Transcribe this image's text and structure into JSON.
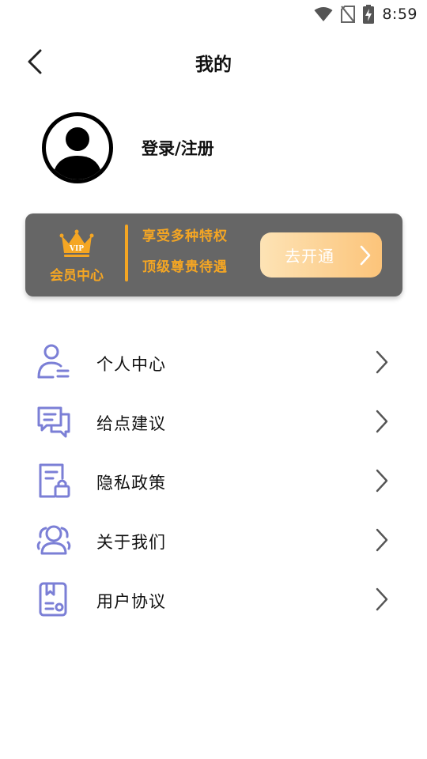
{
  "status_bar": {
    "time": "8:59",
    "icons": [
      "wifi-icon",
      "no-sim-icon",
      "battery-charging-icon"
    ]
  },
  "header": {
    "title": "我的",
    "back_icon": "chevron-left-icon"
  },
  "profile": {
    "avatar_icon": "user-avatar-icon",
    "login_label": "登录/注册"
  },
  "vip": {
    "badge_icon": "vip-crown-icon",
    "badge_text": "VIP",
    "label": "会员中心",
    "perks": [
      "享受多种特权",
      "顶级尊贵待遇"
    ],
    "button_label": "去开通",
    "accent_color": "#f5a623",
    "card_color": "#666666"
  },
  "menu": {
    "icon_color": "#7b7fd6",
    "items": [
      {
        "label": "个人中心",
        "icon": "user-profile-icon"
      },
      {
        "label": "给点建议",
        "icon": "feedback-chat-icon"
      },
      {
        "label": "隐私政策",
        "icon": "privacy-lock-icon"
      },
      {
        "label": "关于我们",
        "icon": "group-users-icon"
      },
      {
        "label": "用户协议",
        "icon": "agreement-document-icon"
      }
    ]
  }
}
